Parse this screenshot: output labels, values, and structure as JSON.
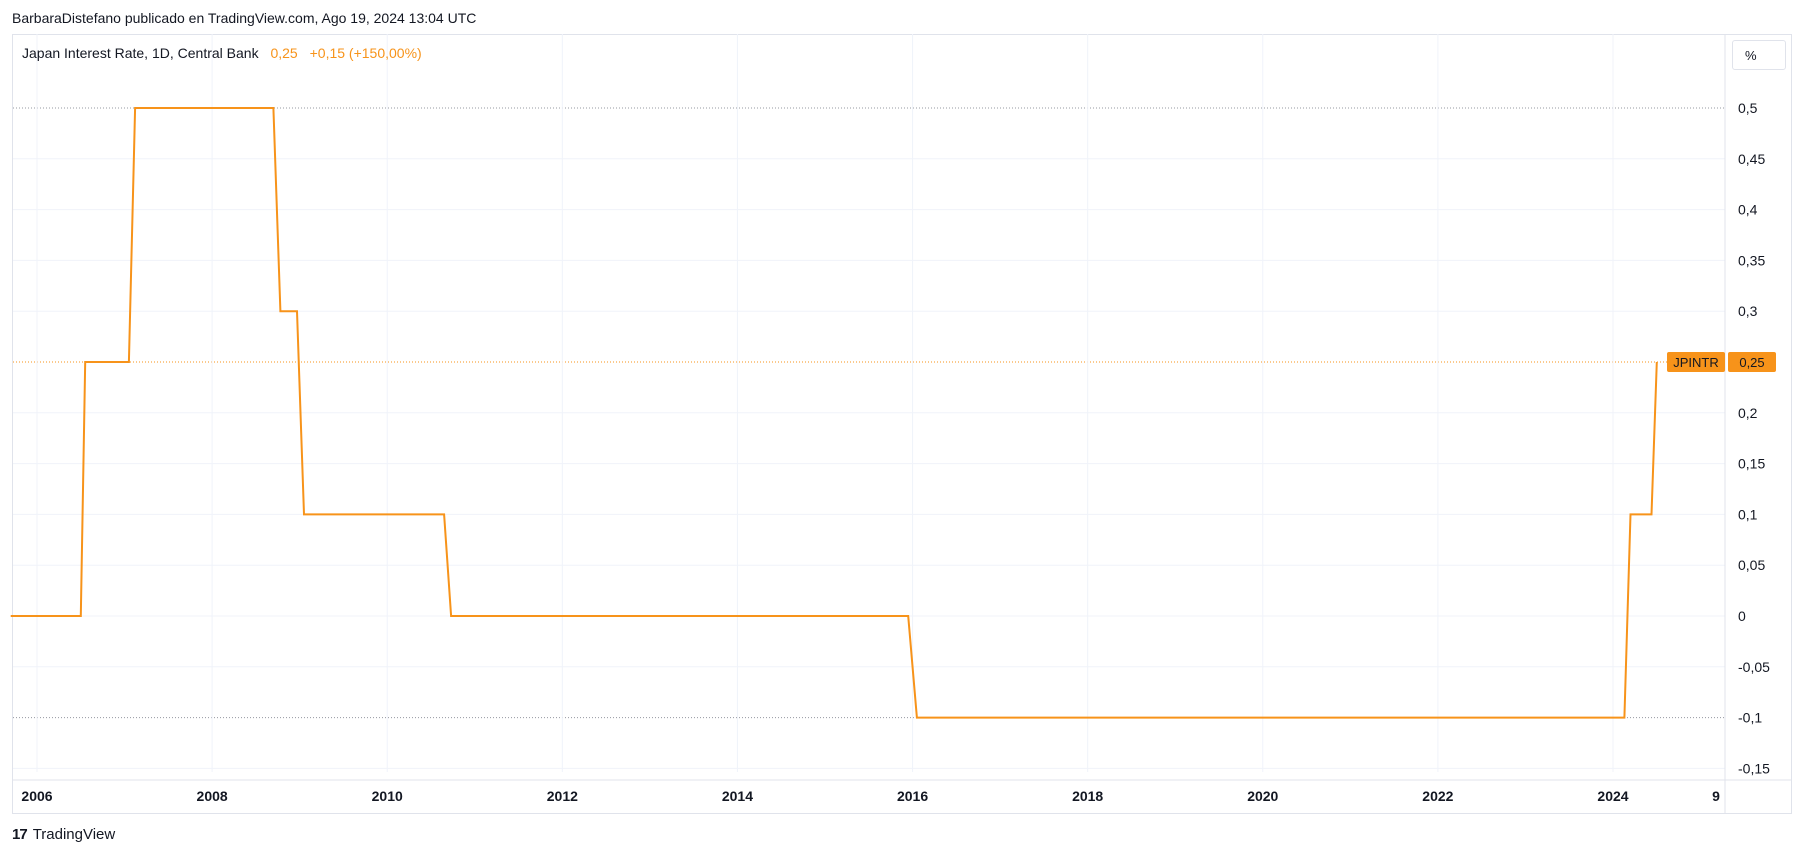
{
  "header": {
    "publisher_line": "BarbaraDistefano publicado en TradingView.com, Ago 19, 2024 13:04 UTC"
  },
  "legend": {
    "symbol_title": "Japan Interest Rate, 1D, Central Bank",
    "last_value": "0,25",
    "change": "+0,15 (+150,00%)"
  },
  "unit_button": "%",
  "price_tag": {
    "symbol": "JPINTR",
    "value": "0,25"
  },
  "footer": {
    "brand": "TradingView",
    "logo_mark": "17"
  },
  "colors": {
    "series": "#f7931a",
    "grid": "#f0f3fa",
    "axis_text": "#131722"
  },
  "chart_data": {
    "type": "line",
    "title": "",
    "xlabel": "",
    "ylabel": "",
    "x_ticks": [
      "2006",
      "2008",
      "2010",
      "2012",
      "2014",
      "2016",
      "2018",
      "2020",
      "2022",
      "2024",
      "9"
    ],
    "y_ticks": [
      "0,5",
      "0,45",
      "0,4",
      "0,35",
      "0,3",
      "0,25",
      "0,2",
      "0,15",
      "0,1",
      "0,05",
      "0",
      "-0,05",
      "-0,1",
      "-0,15"
    ],
    "y_tick_values": [
      0.5,
      0.45,
      0.4,
      0.35,
      0.3,
      0.25,
      0.2,
      0.15,
      0.1,
      0.05,
      0,
      -0.05,
      -0.1,
      -0.15
    ],
    "ylim": [
      -0.15,
      0.5
    ],
    "xlim": [
      2005.7,
      2024.9
    ],
    "grid": true,
    "dotted_levels": [
      0.5,
      0.25,
      -0.1
    ],
    "series": [
      {
        "name": "JPINTR",
        "x": [
          2005.7,
          2006.5,
          2006.55,
          2007.05,
          2007.12,
          2008.7,
          2008.78,
          2008.97,
          2009.05,
          2010.65,
          2010.73,
          2015.95,
          2016.05,
          2024.13,
          2024.2,
          2024.44,
          2024.5
        ],
        "y": [
          0,
          0,
          0.25,
          0.25,
          0.5,
          0.5,
          0.3,
          0.3,
          0.1,
          0.1,
          0,
          0,
          -0.1,
          -0.1,
          0.1,
          0.1,
          0.25
        ]
      }
    ]
  }
}
